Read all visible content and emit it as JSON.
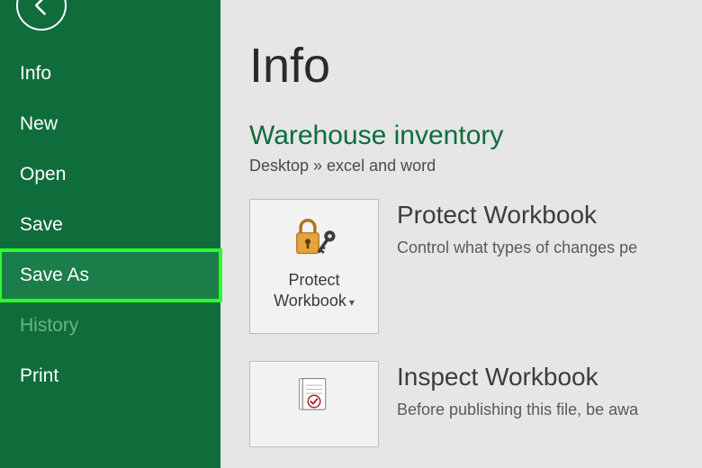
{
  "sidebar": {
    "items": [
      {
        "label": "Info"
      },
      {
        "label": "New"
      },
      {
        "label": "Open"
      },
      {
        "label": "Save"
      },
      {
        "label": "Save As"
      },
      {
        "label": "History"
      },
      {
        "label": "Print"
      }
    ]
  },
  "main": {
    "page_title": "Info",
    "doc_title": "Warehouse inventory",
    "breadcrumb": "Desktop » excel and word",
    "protect": {
      "tile_label": "Protect Workbook",
      "title": "Protect Workbook",
      "desc": "Control what types of changes pe"
    },
    "inspect": {
      "title": "Inspect Workbook",
      "desc": "Before publishing this file, be awa"
    }
  }
}
